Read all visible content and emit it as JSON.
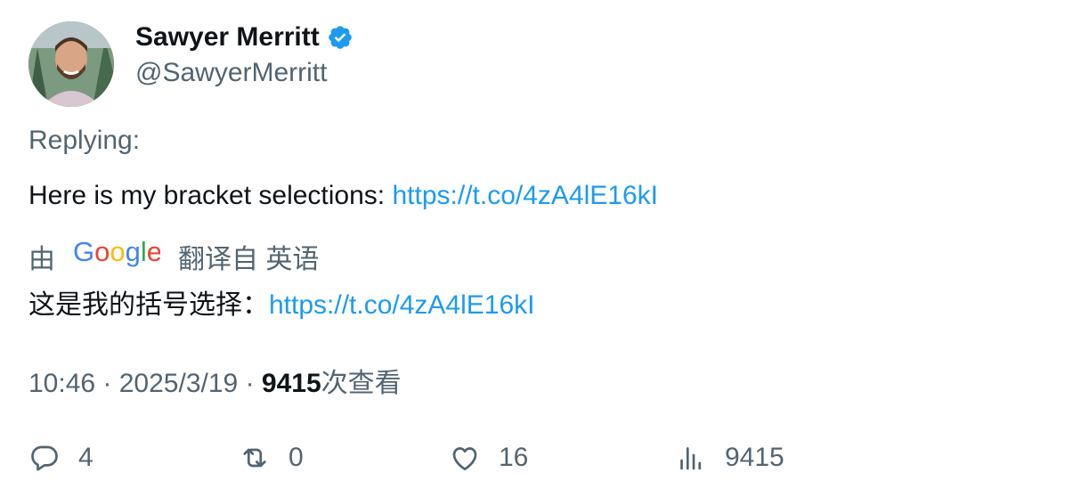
{
  "user": {
    "display_name": "Sawyer Merritt",
    "handle": "@SawyerMerritt"
  },
  "tweet": {
    "replying_label": "Replying:",
    "text": "Here is my bracket selections: ",
    "link": "https://t.co/4zA4lE16kI"
  },
  "translation": {
    "by_label": "由",
    "provider": "Google",
    "from_label": "翻译自 英语",
    "text": "这是我的括号选择：",
    "link": "https://t.co/4zA4lE16kI"
  },
  "meta": {
    "time": "10:46",
    "date": "2025/3/19",
    "views": "9415",
    "views_suffix": "次查看"
  },
  "actions": {
    "replies": "4",
    "retweets": "0",
    "likes": "16",
    "views": "9415"
  },
  "colors": {
    "link": "#1d9bf0",
    "muted": "#536471",
    "text": "#0f1419",
    "verified": "#1d9bf0"
  },
  "icons": [
    "avatar",
    "verified-badge-icon",
    "google-logo",
    "reply-icon",
    "retweet-icon",
    "like-icon",
    "views-icon"
  ]
}
